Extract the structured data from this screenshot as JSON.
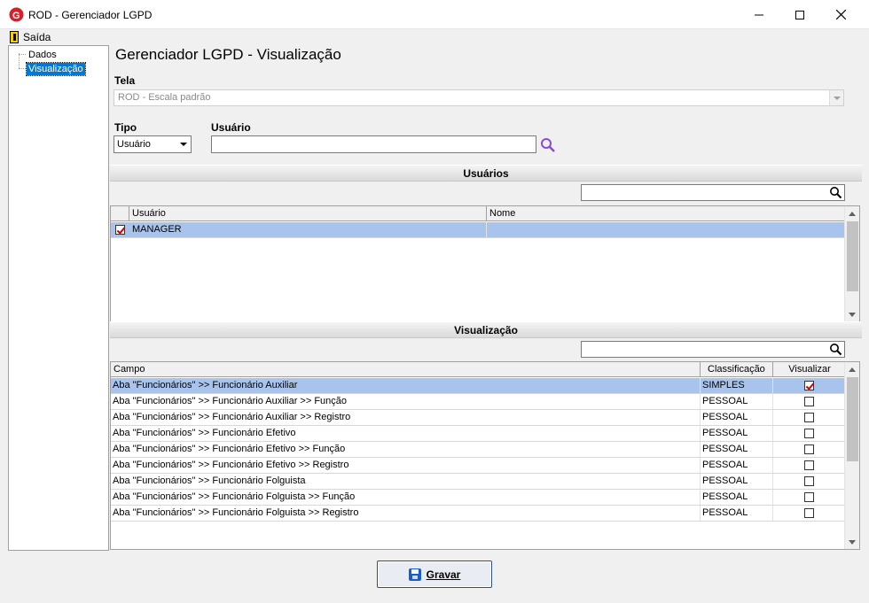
{
  "window": {
    "title": "ROD - Gerenciador LGPD"
  },
  "menu": {
    "exit_label": "Saída"
  },
  "tree": {
    "items": [
      "Dados",
      "Visualização"
    ],
    "selected": "Visualização"
  },
  "page": {
    "title": "Gerenciador LGPD - Visualização"
  },
  "form": {
    "tela_label": "Tela",
    "tela_value": "ROD - Escala padrão",
    "tipo_label": "Tipo",
    "tipo_value": "Usuário",
    "usuario_label": "Usuário",
    "usuario_value": ""
  },
  "usuarios_section": {
    "title": "Usuários",
    "search_value": "",
    "columns": [
      "Usuário",
      "Nome"
    ],
    "rows": [
      {
        "checked": true,
        "usuario": "MANAGER",
        "nome": ""
      }
    ]
  },
  "visualizacao_section": {
    "title": "Visualização",
    "search_value": "",
    "columns": [
      "Campo",
      "Classificação",
      "Visualizar"
    ],
    "rows": [
      {
        "campo": "Aba \"Funcionários\" >> Funcionário Auxiliar",
        "classificacao": "SIMPLES",
        "visualizar": true
      },
      {
        "campo": "Aba \"Funcionários\" >> Funcionário Auxiliar >> Função",
        "classificacao": "PESSOAL",
        "visualizar": false
      },
      {
        "campo": "Aba \"Funcionários\" >> Funcionário Auxiliar >> Registro",
        "classificacao": "PESSOAL",
        "visualizar": false
      },
      {
        "campo": "Aba \"Funcionários\" >> Funcionário Efetivo",
        "classificacao": "PESSOAL",
        "visualizar": false
      },
      {
        "campo": "Aba \"Funcionários\" >> Funcionário Efetivo >> Função",
        "classificacao": "PESSOAL",
        "visualizar": false
      },
      {
        "campo": "Aba \"Funcionários\" >> Funcionário Efetivo >> Registro",
        "classificacao": "PESSOAL",
        "visualizar": false
      },
      {
        "campo": "Aba \"Funcionários\" >> Funcionário Folguista",
        "classificacao": "PESSOAL",
        "visualizar": false
      },
      {
        "campo": "Aba \"Funcionários\" >> Funcionário Folguista >> Função",
        "classificacao": "PESSOAL",
        "visualizar": false
      },
      {
        "campo": "Aba \"Funcionários\" >> Funcionário Folguista >> Registro",
        "classificacao": "PESSOAL",
        "visualizar": false
      }
    ]
  },
  "footer": {
    "save_label": "Gravar"
  },
  "colors": {
    "selection": "#a9c4ec",
    "tree_selection": "#0078d7",
    "logo_red": "#d6202a",
    "search_purple": "#8a4bd6"
  },
  "icons": [
    "app-logo-icon",
    "minimize-icon",
    "maximize-icon",
    "close-icon",
    "exit-door-icon",
    "search-icon",
    "save-disk-icon"
  ]
}
